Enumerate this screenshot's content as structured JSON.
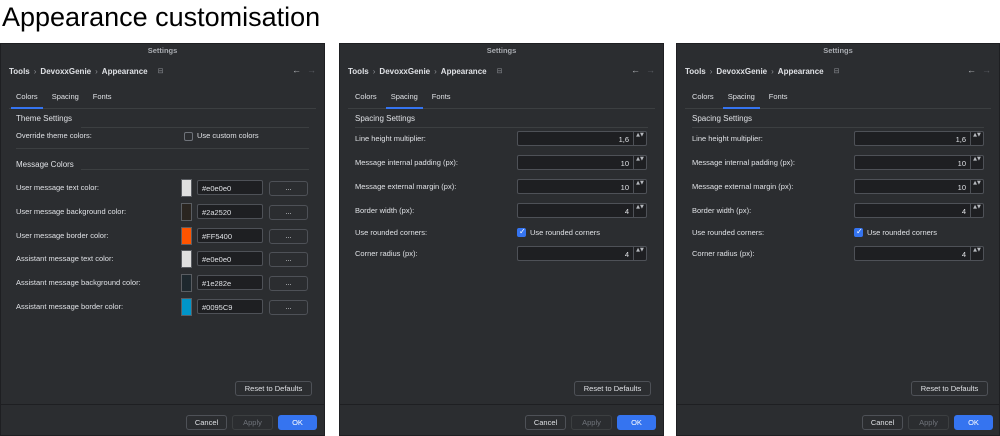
{
  "page_title": "Appearance customisation",
  "window_title": "Settings",
  "breadcrumb": [
    "Tools",
    "DevoxxGenie",
    "Appearance"
  ],
  "breadcrumb_separator": "›",
  "pin_glyph": "⊟",
  "nav": {
    "back": "←",
    "forward": "→"
  },
  "tabs": [
    "Colors",
    "Spacing",
    "Fonts"
  ],
  "colors_panel": {
    "theme_section": "Theme Settings",
    "override_label": "Override theme colors:",
    "custom_colors_checkbox": "Use custom colors",
    "custom_colors_checked": false,
    "message_section": "Message Colors",
    "rows": [
      {
        "label": "User message text color:",
        "hex": "#e0e0e0",
        "swatch": "#e0e0e0"
      },
      {
        "label": "User message background color:",
        "hex": "#2a2520",
        "swatch": "#2a2520"
      },
      {
        "label": "User message border color:",
        "hex": "#FF5400",
        "swatch": "#FF5400"
      },
      {
        "label": "Assistant message text color:",
        "hex": "#e0e0e0",
        "swatch": "#e0e0e0"
      },
      {
        "label": "Assistant message background color:",
        "hex": "#1e282e",
        "swatch": "#1e282e"
      },
      {
        "label": "Assistant message border color:",
        "hex": "#0095C9",
        "swatch": "#0095C9"
      }
    ],
    "dots_label": "..."
  },
  "spacing_panel": {
    "section": "Spacing Settings",
    "line_height_label": "Line height multiplier:",
    "line_height_value": "1,6",
    "internal_padding_label": "Message internal padding (px):",
    "internal_padding_value": "10",
    "external_margin_label": "Message external margin (px):",
    "external_margin_value": "10",
    "border_width_label": "Border width (px):",
    "border_width_value": "4",
    "rounded_label": "Use rounded corners:",
    "rounded_checkbox": "Use rounded corners",
    "rounded_checked": true,
    "corner_radius_label": "Corner radius (px):",
    "corner_radius_value": "4"
  },
  "spinner_arrows": "▲▼",
  "buttons": {
    "reset": "Reset to Defaults",
    "cancel": "Cancel",
    "apply": "Apply",
    "ok": "OK"
  }
}
